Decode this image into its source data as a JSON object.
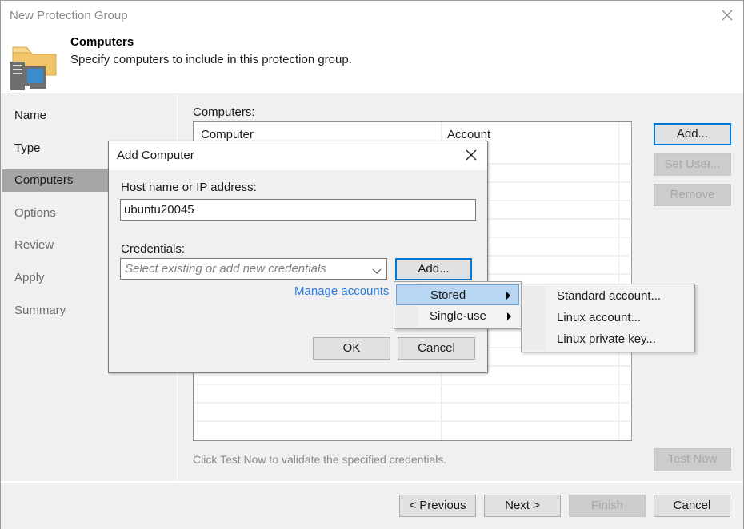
{
  "window": {
    "title": "New Protection Group",
    "close_icon": "close-icon"
  },
  "header": {
    "icon": "computers-folder-icon",
    "title": "Computers",
    "subtitle": "Specify computers to include in this protection group."
  },
  "sidebar": {
    "items": [
      {
        "label": "Name",
        "state": "done"
      },
      {
        "label": "Type",
        "state": "done"
      },
      {
        "label": "Computers",
        "state": "active"
      },
      {
        "label": "Options",
        "state": "todo"
      },
      {
        "label": "Review",
        "state": "todo"
      },
      {
        "label": "Apply",
        "state": "todo"
      },
      {
        "label": "Summary",
        "state": "todo"
      }
    ]
  },
  "main": {
    "computers_label": "Computers:",
    "table": {
      "columns": [
        "Computer",
        "Account"
      ],
      "rows": []
    },
    "buttons": {
      "add": "Add...",
      "set_user": "Set User...",
      "remove": "Remove",
      "test_now": "Test Now"
    },
    "hint": "Click Test Now to validate the specified credentials."
  },
  "footer": {
    "previous": "< Previous",
    "next": "Next >",
    "finish": "Finish",
    "cancel": "Cancel"
  },
  "dialog": {
    "title": "Add Computer",
    "host_label": "Host name or IP address:",
    "host_value": "ubuntu20045",
    "credentials_label": "Credentials:",
    "credentials_placeholder": "Select existing or add new credentials",
    "add_button": "Add...",
    "manage_accounts_link": "Manage accounts",
    "ok": "OK",
    "cancel": "Cancel"
  },
  "add_menu": {
    "items": [
      {
        "label": "Stored",
        "highlighted": true,
        "has_submenu": true
      },
      {
        "label": "Single-use",
        "highlighted": false,
        "has_submenu": true
      }
    ]
  },
  "stored_submenu": {
    "items": [
      {
        "label": "Standard account..."
      },
      {
        "label": "Linux account..."
      },
      {
        "label": "Linux private key..."
      }
    ]
  },
  "colors": {
    "accent_focus": "#0078d7",
    "link": "#2d7de0",
    "menu_highlight": "#b8d6f2",
    "active_nav": "#a6a6a6"
  }
}
